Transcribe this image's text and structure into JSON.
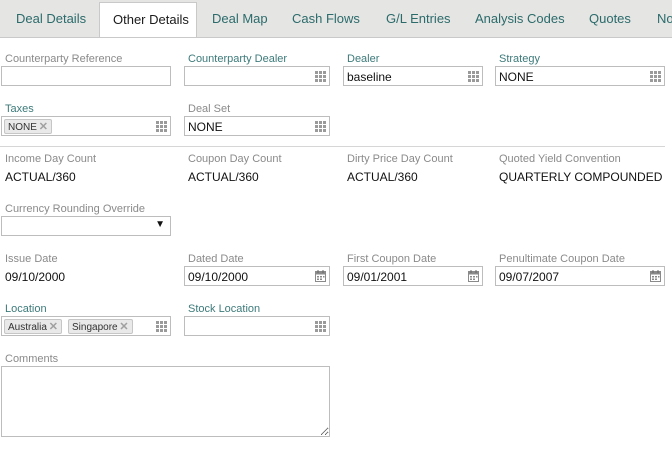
{
  "tabs": [
    "Deal Details",
    "Other Details",
    "Deal Map",
    "Cash Flows",
    "G/L Entries",
    "Analysis Codes",
    "Quotes",
    "No"
  ],
  "fields": {
    "counterparty_reference": {
      "label": "Counterparty Reference",
      "value": ""
    },
    "counterparty_dealer": {
      "label": "Counterparty Dealer",
      "value": ""
    },
    "dealer": {
      "label": "Dealer",
      "value": "baseline"
    },
    "strategy": {
      "label": "Strategy",
      "value": "NONE"
    },
    "taxes": {
      "label": "Taxes",
      "chips": [
        "NONE"
      ]
    },
    "deal_set": {
      "label": "Deal Set",
      "value": "NONE"
    },
    "income_day_count": {
      "label": "Income Day Count",
      "value": "ACTUAL/360"
    },
    "coupon_day_count": {
      "label": "Coupon Day Count",
      "value": "ACTUAL/360"
    },
    "dirty_price_day_count": {
      "label": "Dirty Price Day Count",
      "value": "ACTUAL/360"
    },
    "quoted_yield_convention": {
      "label": "Quoted Yield Convention",
      "value": "QUARTERLY COMPOUNDED"
    },
    "currency_rounding_override": {
      "label": "Currency Rounding Override",
      "value": ""
    },
    "issue_date": {
      "label": "Issue Date",
      "value": "09/10/2000"
    },
    "dated_date": {
      "label": "Dated Date",
      "value": "09/10/2000"
    },
    "first_coupon_date": {
      "label": "First Coupon Date",
      "value": "09/01/2001"
    },
    "penultimate_coupon_date": {
      "label": "Penultimate Coupon Date",
      "value": "09/07/2007"
    },
    "location": {
      "label": "Location",
      "chips": [
        "Australia",
        "Singapore"
      ]
    },
    "stock_location": {
      "label": "Stock Location",
      "value": ""
    },
    "comments": {
      "label": "Comments",
      "value": ""
    }
  },
  "icons": {
    "chip_remove": "remove-x-icon",
    "lookup": "grid-lookup-icon",
    "calendar": "calendar-icon",
    "dropdown": "dropdown-arrow-icon"
  },
  "colors": {
    "tab_bar": "#e5e5e3",
    "link_label": "#3d7a7a",
    "label": "#8a8a8a"
  }
}
